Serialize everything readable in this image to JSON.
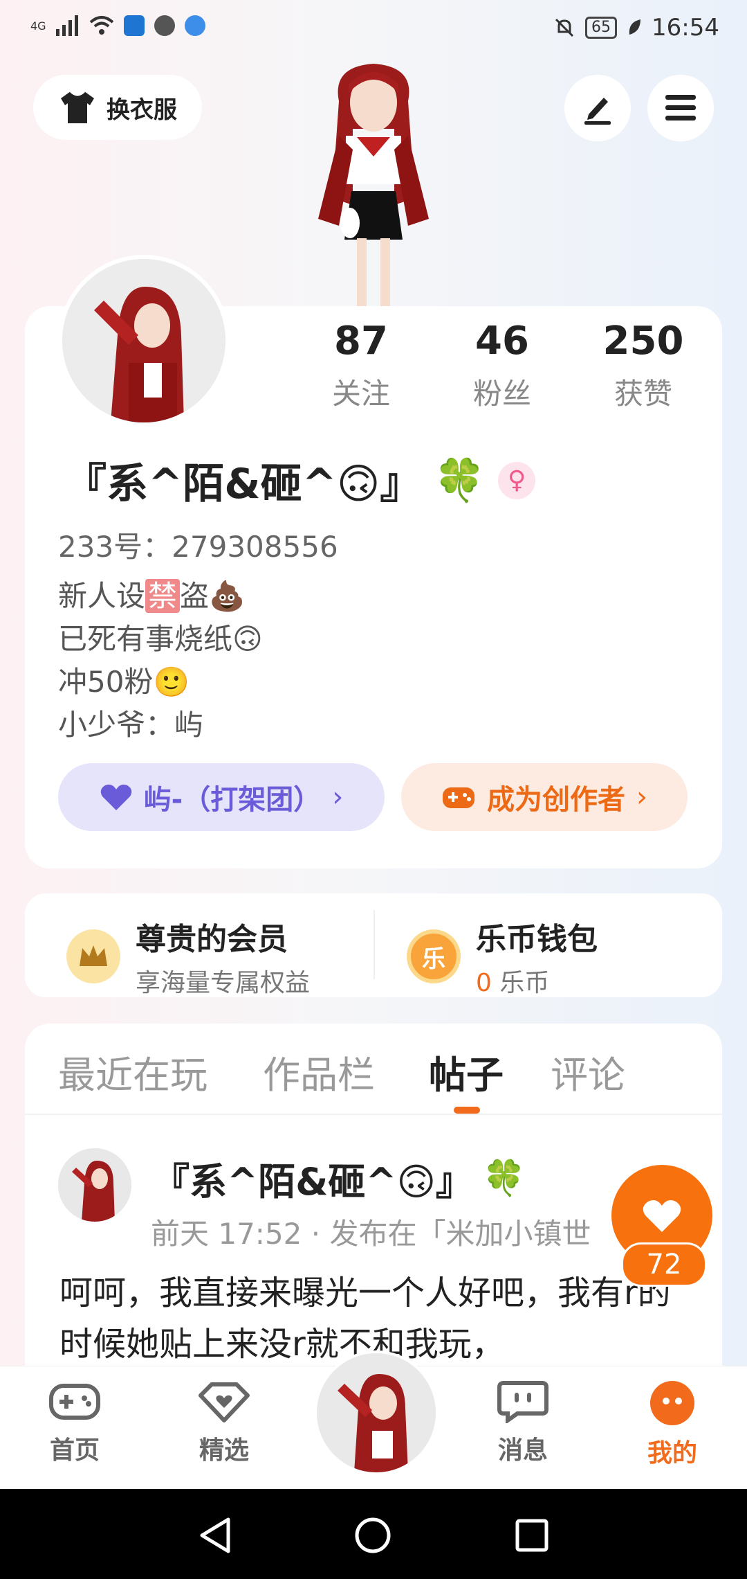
{
  "status_bar": {
    "network": "4G",
    "battery": "65",
    "time": "16:54"
  },
  "top": {
    "wardrobe_label": "换衣服",
    "edit_icon": "pencil-icon",
    "menu_icon": "hamburger-menu-icon"
  },
  "profile": {
    "stats": [
      {
        "value": "87",
        "label": "关注"
      },
      {
        "value": "46",
        "label": "粉丝"
      },
      {
        "value": "250",
        "label": "获赞"
      }
    ],
    "name": "『系^陌&砸^🙃』",
    "clover": "🍀",
    "gender_symbol": "♀",
    "uid": "233号：279308556",
    "bio": {
      "line1_pre": "新人设",
      "line1_badge": "禁",
      "line1_mid": "盗",
      "line1_emoji": "💩",
      "line2": "已死有事烧纸🙃",
      "line3": "冲50粉🙂",
      "line4": "小少爷：屿"
    },
    "team_label": "屿-（打架团）",
    "creator_label": "成为创作者"
  },
  "membership": {
    "vip_title": "尊贵的会员",
    "vip_sub": "享海量专属权益",
    "wallet_title": "乐币钱包",
    "wallet_amount": "0",
    "wallet_unit": "乐币",
    "coin_glyph": "乐"
  },
  "tabs": [
    {
      "label": "最近在玩"
    },
    {
      "label": "作品栏"
    },
    {
      "label": "帖子"
    },
    {
      "label": "评论"
    }
  ],
  "post": {
    "author": "『系^陌&砸^🙃』",
    "clover": "🍀",
    "meta": "前天 17:52 · 发布在「米加小镇世",
    "text": "呵呵，我直接来曝光一个人好吧，我有r的时候她贴上来没r就不和我玩，",
    "like_count": "72"
  },
  "bottom_nav": [
    {
      "label": "首页"
    },
    {
      "label": "精选"
    },
    {
      "label": "消息"
    },
    {
      "label": "我的"
    }
  ],
  "colors": {
    "accent": "#f26a1b",
    "team": "#6a5bd8"
  }
}
